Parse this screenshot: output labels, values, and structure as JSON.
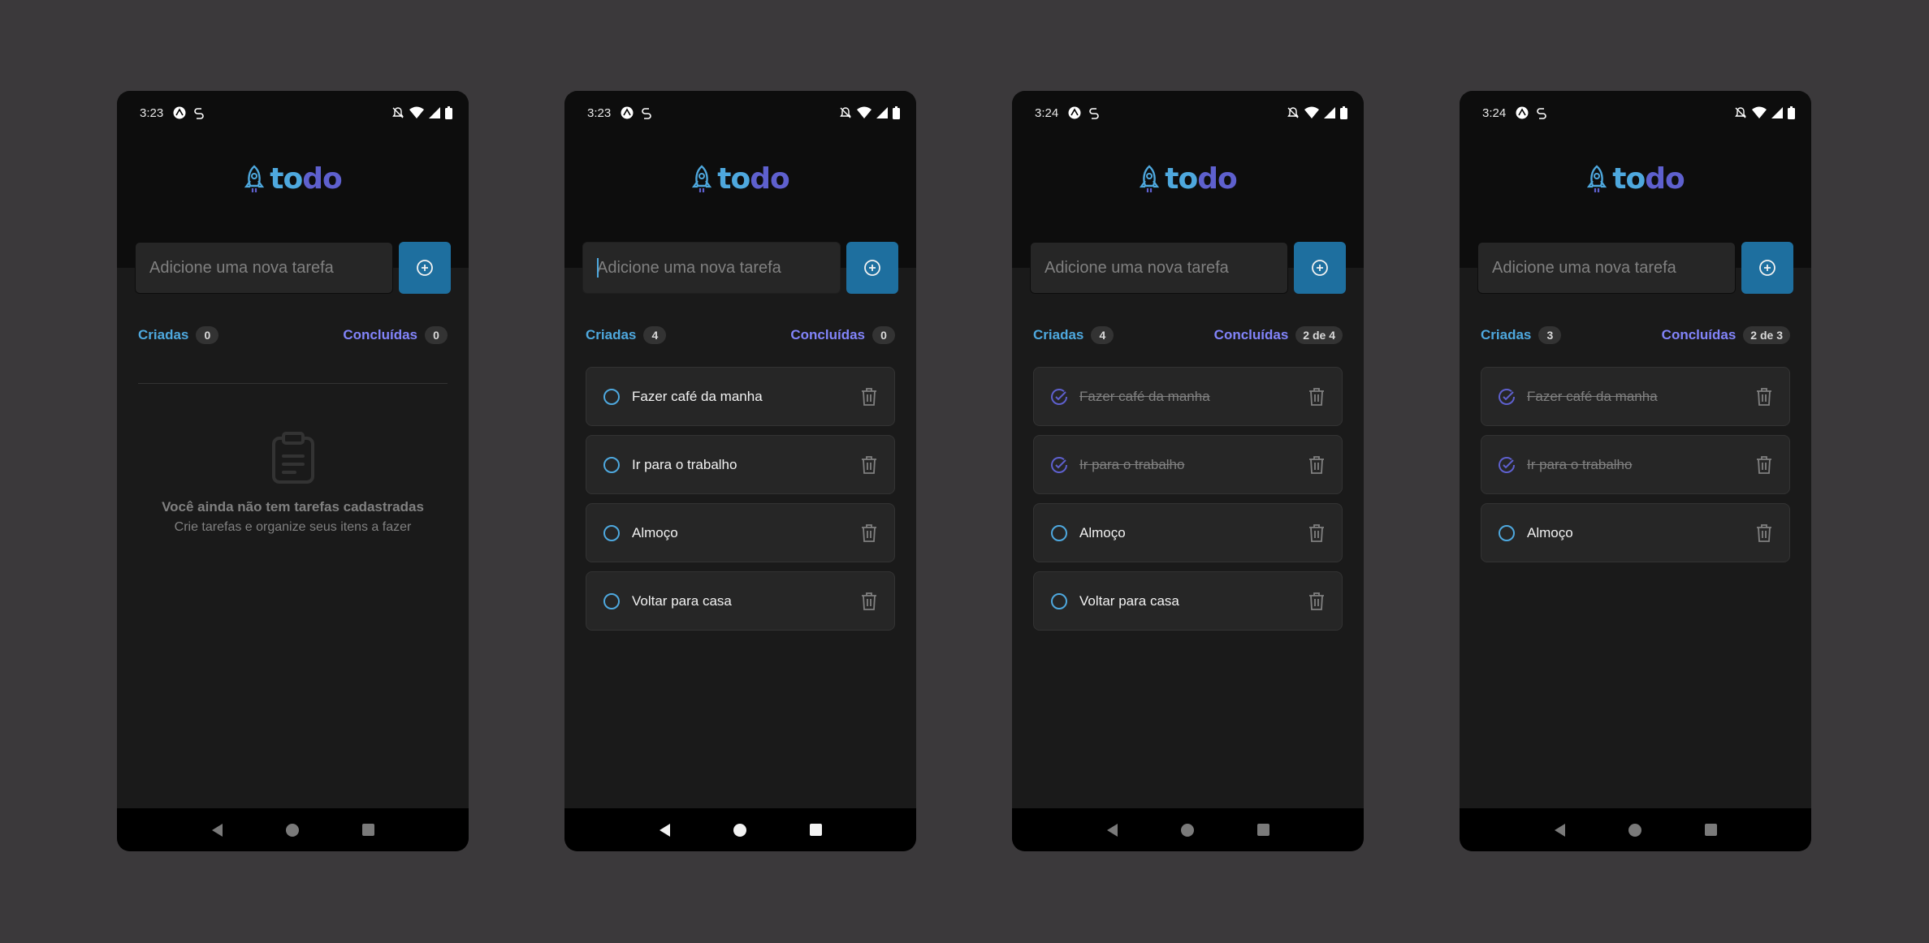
{
  "app": {
    "logo_to": "to",
    "logo_do": "do",
    "input_placeholder": "Adicione uma nova tarefa",
    "created_label": "Criadas",
    "done_label": "Concluídas",
    "empty_title": "Você ainda não tem tarefas cadastradas",
    "empty_subtitle": "Crie tarefas e organize seus itens a fazer"
  },
  "colors": {
    "blue": "#4ea8de",
    "purple": "#5e60ce",
    "purple_light": "#8284fa",
    "blue_dark": "#1e6f9f"
  },
  "screens": [
    {
      "time": "3:23",
      "created_count": "0",
      "done_count": "0",
      "tasks": []
    },
    {
      "time": "3:23",
      "created_count": "4",
      "done_count": "0",
      "tasks": [
        {
          "text": "Fazer café da manha",
          "done": false
        },
        {
          "text": "Ir para o trabalho",
          "done": false
        },
        {
          "text": "Almoço",
          "done": false
        },
        {
          "text": "Voltar para casa",
          "done": false
        }
      ]
    },
    {
      "time": "3:24",
      "created_count": "4",
      "done_count": "2 de 4",
      "tasks": [
        {
          "text": "Fazer café da manha",
          "done": true
        },
        {
          "text": "Ir para o trabalho",
          "done": true
        },
        {
          "text": "Almoço",
          "done": false
        },
        {
          "text": "Voltar para casa",
          "done": false
        }
      ]
    },
    {
      "time": "3:24",
      "created_count": "3",
      "done_count": "2 de 3",
      "tasks": [
        {
          "text": "Fazer café da manha",
          "done": true
        },
        {
          "text": "Ir para o trabalho",
          "done": true
        },
        {
          "text": "Almoço",
          "done": false
        }
      ]
    }
  ]
}
